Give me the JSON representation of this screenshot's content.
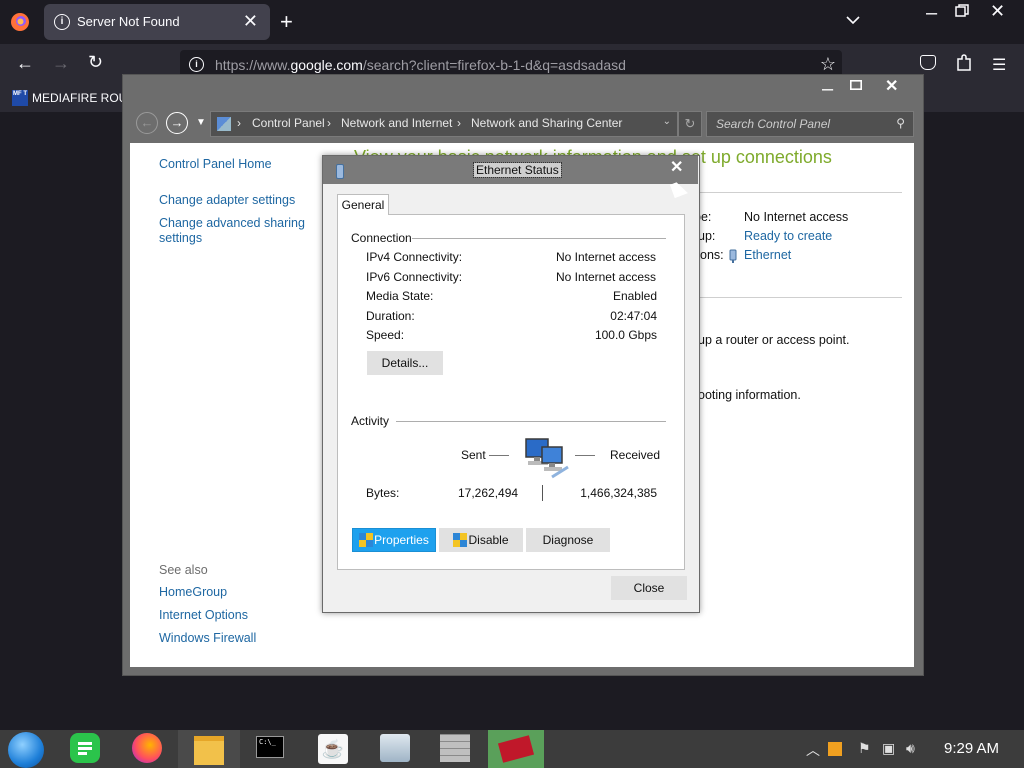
{
  "browser": {
    "tab_title": "Server Not Found",
    "tab_close": "✕",
    "new_tab": "+",
    "url_prefix": "https://www.",
    "url_host": "google.com",
    "url_rest": "/search?client=firefox-b-1-d&q=asdsadasd",
    "bookmark_label": "MEDIAFIRE ROUL",
    "bookmark_icon_text": "MF T"
  },
  "control_panel": {
    "breadcrumbs": [
      "Control Panel",
      "Network and Internet",
      "Network and Sharing Center"
    ],
    "search_placeholder": "Search Control Panel",
    "sidebar": {
      "home": "Control Panel Home",
      "change_adapter": "Change adapter settings",
      "change_sharing_line1": "Change advanced sharing",
      "change_sharing_line2": "settings",
      "see_also": "See also",
      "homegroup": "HomeGroup",
      "internet_options": "Internet Options",
      "windows_firewall": "Windows Firewall"
    },
    "main": {
      "heading_partial": "View your basic network information and set up connections",
      "access_type_suffix": "pe:",
      "access_type_value": "No Internet access",
      "homegroup_suffix": "up:",
      "homegroup_value": "Ready to create",
      "connections_suffix": "ons:",
      "connections_value": "Ethernet",
      "router_text": "up a router or access point.",
      "troubleshoot_text": "ooting information."
    }
  },
  "dialog": {
    "title": "Ethernet Status",
    "tab_general": "General",
    "connection_group": "Connection",
    "rows": [
      {
        "label": "IPv4 Connectivity:",
        "value": "No Internet access"
      },
      {
        "label": "IPv6 Connectivity:",
        "value": "No Internet access"
      },
      {
        "label": "Media State:",
        "value": "Enabled"
      },
      {
        "label": "Duration:",
        "value": "02:47:04"
      },
      {
        "label": "Speed:",
        "value": "100.0 Gbps"
      }
    ],
    "details_button": "Details...",
    "activity_group": "Activity",
    "sent_label": "Sent",
    "received_label": "Received",
    "bytes_label": "Bytes:",
    "bytes_sent": "17,262,494",
    "bytes_received": "1,466,324,385",
    "properties_button": "Properties",
    "disable_button": "Disable",
    "diagnose_button": "Diagnose",
    "close_button": "Close"
  },
  "taskbar": {
    "clock": "9:29 AM",
    "terminal_text": "C:\\_"
  }
}
